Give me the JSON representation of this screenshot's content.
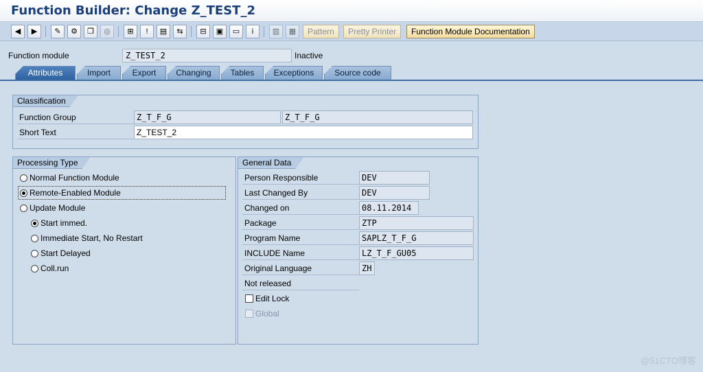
{
  "window": {
    "title": "Function Builder: Change Z_TEST_2"
  },
  "toolbar": {
    "icons": [
      "back-arrow-icon",
      "forward-arrow-icon",
      "display-change-icon",
      "activate-icon",
      "other-object-icon",
      "where-used-icon",
      "navigate-icon",
      "display-object-list-icon",
      "insert-icon",
      "hierarchy-icon",
      "print-icon",
      "frame-icon",
      "info-icon",
      "test-icon",
      "function-module-icon"
    ],
    "pattern_label": "Pattern",
    "pretty_printer_label": "Pretty Printer",
    "documentation_label": "Function Module Documentation"
  },
  "header": {
    "function_module_label": "Function module",
    "function_module_value": "Z_TEST_2",
    "status": "Inactive"
  },
  "tabs": [
    {
      "label": "Attributes",
      "active": true
    },
    {
      "label": "Import"
    },
    {
      "label": "Export"
    },
    {
      "label": "Changing"
    },
    {
      "label": "Tables"
    },
    {
      "label": "Exceptions"
    },
    {
      "label": "Source code"
    }
  ],
  "classification": {
    "title": "Classification",
    "function_group_label": "Function Group",
    "function_group_value": "Z_T_F_G",
    "function_group_text": "Z_T_F_G",
    "short_text_label": "Short Text",
    "short_text_value": "Z_TEST_2"
  },
  "processing_type": {
    "title": "Processing Type",
    "options": [
      {
        "label": "Normal Function Module",
        "selected": false
      },
      {
        "label": "Remote-Enabled Module",
        "selected": true
      },
      {
        "label": "Update Module",
        "selected": false
      }
    ],
    "update_options": [
      {
        "label": "Start immed.",
        "selected": true
      },
      {
        "label": "Immediate Start, No Restart",
        "selected": false
      },
      {
        "label": "Start Delayed",
        "selected": false
      },
      {
        "label": "Coll.run",
        "selected": false
      }
    ]
  },
  "general_data": {
    "title": "General Data",
    "fields": [
      {
        "label": "Person Responsible",
        "value": "DEV"
      },
      {
        "label": "Last Changed By",
        "value": "DEV"
      },
      {
        "label": "Changed on",
        "value": "08.11.2014"
      },
      {
        "label": "Package",
        "value": "ZTP"
      },
      {
        "label": "Program Name",
        "value": "SAPLZ_T_F_G"
      },
      {
        "label": "INCLUDE Name",
        "value": "LZ_T_F_GU05"
      },
      {
        "label": "Original Language",
        "value": "ZH"
      }
    ],
    "release_status": "Not released",
    "edit_lock_label": "Edit Lock",
    "global_label": "Global"
  },
  "watermark": "@51CTO博客"
}
